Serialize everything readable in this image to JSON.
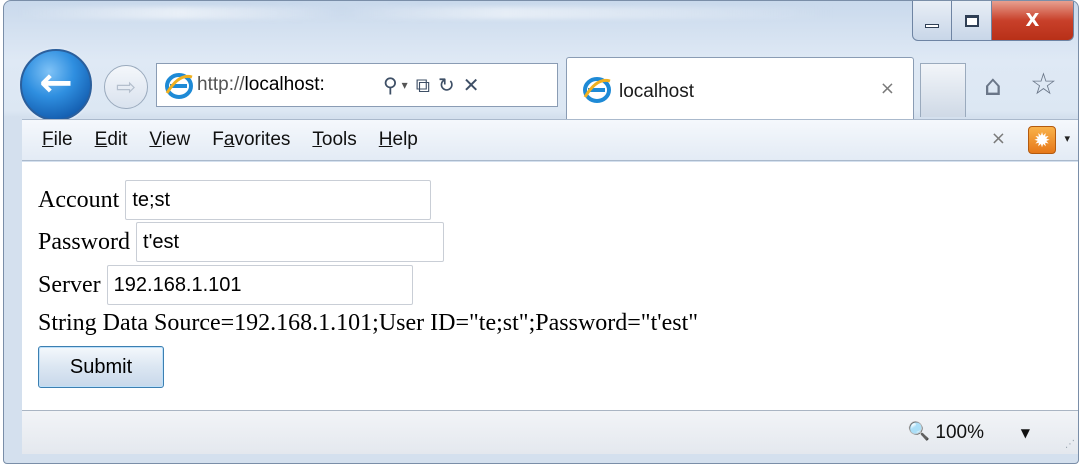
{
  "window": {
    "minimize_glyph": "",
    "close_glyph": "X"
  },
  "nav": {
    "back_glyph": "←",
    "forward_glyph": "⇨"
  },
  "address": {
    "scheme": "http://",
    "host": "localhost:",
    "search_glyph": "⚲",
    "dropdown_glyph": "▾",
    "compat_glyph": "⧉",
    "refresh_glyph": "↻",
    "stop_glyph": "✕"
  },
  "tab": {
    "title": "localhost",
    "close_glyph": "×"
  },
  "toolbar": {
    "home_glyph": "⌂",
    "favorites_glyph": "☆"
  },
  "menu": {
    "items": [
      {
        "accel": "F",
        "rest": "ile"
      },
      {
        "accel": "E",
        "rest": "dit"
      },
      {
        "accel": "V",
        "rest": "iew"
      },
      {
        "pre": "F",
        "accel": "a",
        "rest": "vorites"
      },
      {
        "accel": "T",
        "rest": "ools"
      },
      {
        "accel": "H",
        "rest": "elp"
      }
    ],
    "close_glyph": "×",
    "gear_glyph": "✹",
    "gear_arrow": "▾"
  },
  "form": {
    "account_label": "Account",
    "account_value": "te;st",
    "password_label": "Password",
    "password_value": "t'est",
    "server_label": "Server",
    "server_value": "192.168.1.101",
    "output_line": "String Data Source=192.168.1.101;User ID=\"te;st\";Password=\"t'est\"",
    "submit_label": "Submit"
  },
  "status": {
    "zoom_glyph": "🔍",
    "zoom": "100%",
    "zoom_arrow": "▼",
    "grip": "⋰"
  },
  "colors": {
    "accent": "#2f8fe0",
    "close_button": "#c8402a",
    "gear": "#e6781a"
  }
}
